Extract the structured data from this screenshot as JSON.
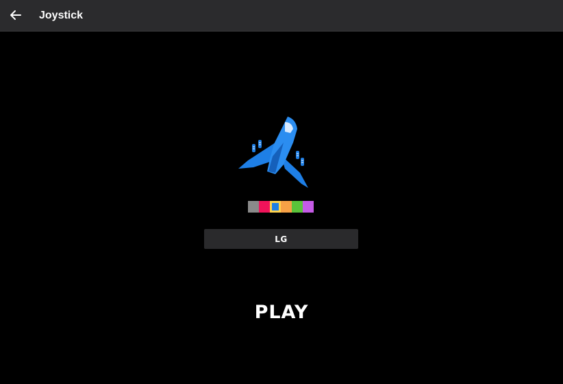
{
  "app_bar": {
    "title": "Joystick",
    "back_icon": "arrow-left-icon"
  },
  "ship": {
    "icon": "spaceship-icon",
    "color": "#1f7fe5"
  },
  "color_picker": {
    "swatches": [
      {
        "name": "gray",
        "color": "#8a8a8a",
        "selected": false
      },
      {
        "name": "red",
        "color": "#f0135a",
        "selected": false
      },
      {
        "name": "blue",
        "color": "#1f7fe5",
        "selected": true
      },
      {
        "name": "orange",
        "color": "#f7a146",
        "selected": false
      },
      {
        "name": "green",
        "color": "#5ac33a",
        "selected": false
      },
      {
        "name": "purple",
        "color": "#c55be6",
        "selected": false
      }
    ],
    "selected_border_color": "#ffd34d"
  },
  "name_field": {
    "value": "LG"
  },
  "play_button": {
    "label": "PLAY"
  }
}
